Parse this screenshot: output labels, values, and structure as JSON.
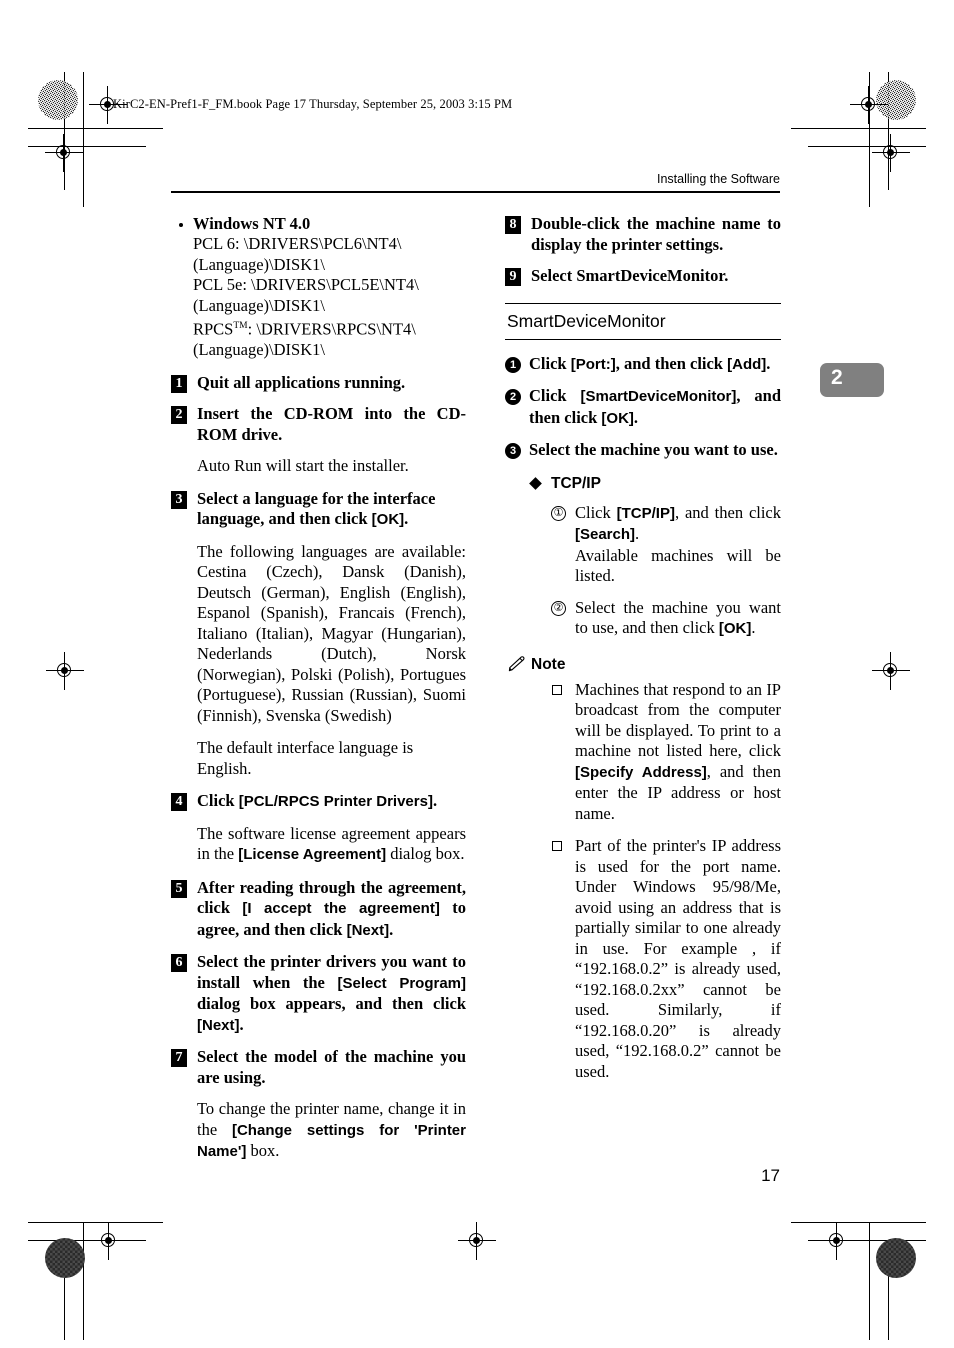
{
  "prepress": {
    "filestamp": "KirC2-EN-Pref1-F_FM.book  Page 17  Thursday, September 25, 2003  3:15 PM"
  },
  "header": {
    "running_head": "Installing the Software"
  },
  "chapter_tab": {
    "number": "2"
  },
  "footer": {
    "page_number": "17"
  },
  "left_column": {
    "os_bullet": {
      "title": "Windows NT 4.0",
      "paths": [
        "PCL 6: \\DRIVERS\\PCL6\\NT4\\",
        "(Language)\\DISK1\\",
        "PCL 5e: \\DRIVERS\\PCL5E\\NT4\\",
        "(Language)\\DISK1\\",
        "RPCS",
        ": \\DRIVERS\\RPCS\\NT4\\",
        "(Language)\\DISK1\\"
      ],
      "trademark": "TM"
    },
    "steps": [
      {
        "number": "1",
        "text": "Quit all applications running."
      },
      {
        "number": "2",
        "text": "Insert the CD-ROM into the CD-ROM drive.",
        "body": "Auto Run will start the installer."
      },
      {
        "number": "3",
        "text_before": "Select a language for the interface language, and then click ",
        "ui": "[OK]",
        "text_after": ".",
        "body1": "The following languages are available: Cestina (Czech), Dansk (Danish), Deutsch (German), English (English), Espanol (Spanish), Francais (French), Italiano (Italian), Magyar (Hungarian), Nederlands (Dutch), Norsk (Norwegian), Polski (Polish), Portugues (Portuguese), Russian (Russian), Suomi (Finnish), Svenska (Swedish)",
        "body2": "The default interface language is English."
      },
      {
        "number": "4",
        "text_before": "Click ",
        "ui": "[PCL/RPCS Printer Drivers]",
        "text_after": ".",
        "body_before": "The software license agreement appears in the ",
        "body_ui": "[License Agreement]",
        "body_after": " dialog box."
      },
      {
        "number": "5",
        "text_before": "After reading through the agreement, click ",
        "ui": "[I accept the agreement]",
        "text_mid": " to agree, and then click ",
        "ui2": "[Next]",
        "text_after": "."
      },
      {
        "number": "6",
        "text_before": "Select the printer drivers you want to install when the ",
        "ui": "[Select Program]",
        "text_mid": " dialog box appears, and then click ",
        "ui2": "[Next]",
        "text_after": "."
      },
      {
        "number": "7",
        "text": "Select the model of the machine you are using.",
        "body_before": "To change the printer name, change it in the ",
        "body_ui": "[Change settings for 'Printer Name']",
        "body_after": " box."
      }
    ]
  },
  "right_column": {
    "steps": [
      {
        "number": "8",
        "text": "Double-click the machine name to display the printer settings."
      },
      {
        "number": "9",
        "text": "Select SmartDeviceMonitor."
      }
    ],
    "section": {
      "title": "SmartDeviceMonitor",
      "substeps": [
        {
          "number": "1",
          "text_before": "Click ",
          "ui": "[Port:]",
          "text_mid": ", and then click ",
          "ui2": "[Add]",
          "text_after": "."
        },
        {
          "number": "2",
          "text_before": "Click ",
          "ui": "[SmartDeviceMonitor]",
          "text_mid": ", and then click ",
          "ui2": "[OK]",
          "text_after": "."
        },
        {
          "number": "3",
          "text": "Select the machine you want to use."
        }
      ],
      "tcpip_heading": "TCP/IP",
      "tcpip_items": [
        {
          "number": "①",
          "text_before": "Click ",
          "ui": "[TCP/IP]",
          "text_mid": ", and then click ",
          "ui2": "[Search]",
          "text_after": ".",
          "continuation": "Available machines will be listed."
        },
        {
          "number": "②",
          "text_before": "Select the machine you want to use, and then click ",
          "ui": "[OK]",
          "text_after": "."
        }
      ],
      "note": {
        "label": "Note",
        "items": [
          {
            "text_before": "Machines that respond to an IP broadcast from the computer will be displayed. To print to a machine not listed here, click ",
            "ui": "[Specify Address]",
            "text_after": ", and then enter the IP address or host name."
          },
          {
            "text": "Part of the printer's IP address is used for the port name. Under Windows 95/98/Me, avoid using an address that is partially similar to one already in use. For example , if “192.168.0.2” is already used, “192.168.0.2xx” cannot be used. Similarly, if “192.168.0.20” is already used, “192.168.0.2” cannot be used."
          }
        ]
      }
    }
  }
}
